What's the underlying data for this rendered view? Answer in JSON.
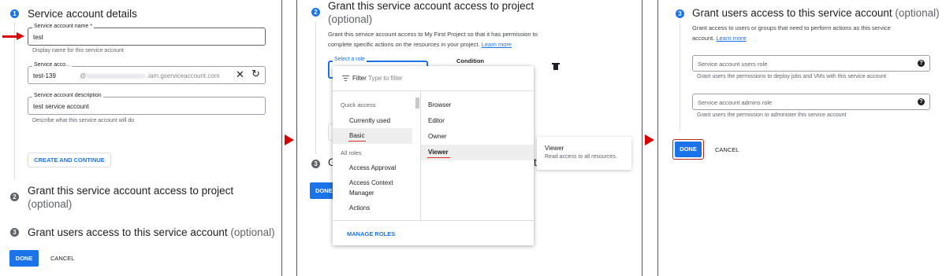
{
  "panel1": {
    "step1": {
      "num": "1",
      "title": "Service account details"
    },
    "name_field": {
      "label": "Service account name *",
      "value": "test",
      "helper": "Display name for this service account"
    },
    "id_field": {
      "label": "Service acco...",
      "value": "test-139",
      "domain": "@",
      "suffix": ".iam.gserviceaccount.com"
    },
    "desc_field": {
      "label": "Service account description",
      "value": "test service account",
      "helper": "Describe what this service account will do"
    },
    "create_button": "CREATE AND CONTINUE",
    "step2": {
      "num": "2",
      "title": "Grant this service account access to project",
      "optional": "(optional)"
    },
    "step3": {
      "num": "3",
      "title": "Grant users access to this service account",
      "optional": "(optional)"
    },
    "done": "DONE",
    "cancel": "CANCEL"
  },
  "panel2": {
    "step2": {
      "num": "2",
      "title": "Grant this service account access to project",
      "optional": "(optional)"
    },
    "desc1": "Grant this service account access to My First Project so that it has permission to",
    "desc2": "complete specific actions on the resources in your project.",
    "learn_more": "Learn more",
    "select_role_label": "Select a role",
    "condition_label": "Condition",
    "filter_label": "Filter",
    "filter_placeholder": "Type to filter",
    "left_list": {
      "quick_access": "Quick access",
      "currently_used": "Currently used",
      "basic": "Basic",
      "all_roles": "All roles",
      "access_approval": "Access Approval",
      "acm_line1": "Access Context",
      "acm_line2": "Manager",
      "actions": "Actions"
    },
    "right_list": [
      "Browser",
      "Editor",
      "Owner",
      "Viewer"
    ],
    "manage_roles": "MANAGE ROLES",
    "tooltip": {
      "title": "Viewer",
      "desc": "Read access to all resources."
    },
    "step3_partial": {
      "num": "3",
      "letter": "G",
      "tail": "t"
    },
    "done_partial": "DONE"
  },
  "panel3": {
    "step3": {
      "num": "3",
      "title": "Grant users access to this service account",
      "optional": "(optional)"
    },
    "desc1": "Grant access to users or groups that need to perform actions as this service",
    "desc2": "account.",
    "learn_more": "Learn more",
    "users_role": {
      "placeholder": "Service account users role",
      "helper": "Grant users the permissions to deploy jobs and VMs with this service account"
    },
    "admins_role": {
      "placeholder": "Service account admins role",
      "helper": "Grant users the permission to administer this service account"
    },
    "done": "DONE",
    "cancel": "CANCEL"
  },
  "colors": {
    "accent": "#1a73e8",
    "arrow": "#d80000",
    "underline": "#d93025"
  }
}
